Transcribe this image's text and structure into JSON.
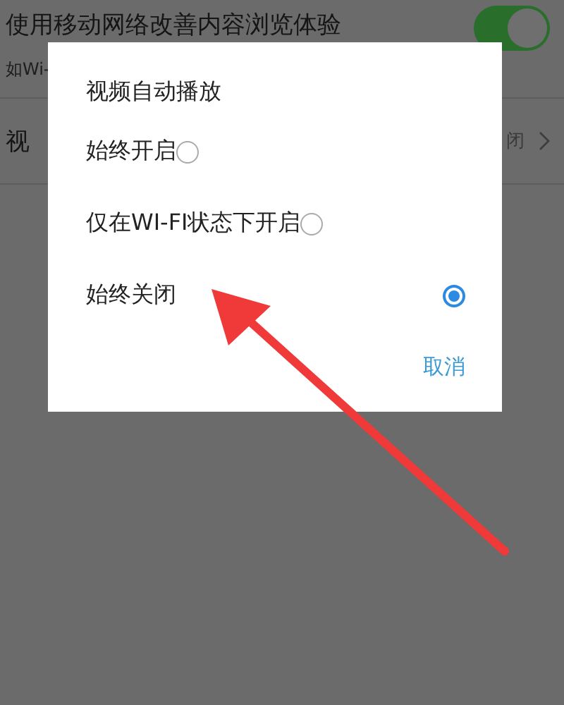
{
  "settings": [
    {
      "title": "使用移动网络改善内容浏览体验",
      "subtitle": "如Wi-",
      "kind": "toggle",
      "on": true
    },
    {
      "title": "视",
      "value": "闭",
      "kind": "link"
    }
  ],
  "dialog": {
    "title": "视频自动播放",
    "options": [
      {
        "label": "始终开启",
        "selected": false
      },
      {
        "label": "仅在WI-FI状态下开启",
        "selected": false
      },
      {
        "label": "始终关闭",
        "selected": true
      }
    ],
    "buttons": [
      "取消"
    ]
  }
}
